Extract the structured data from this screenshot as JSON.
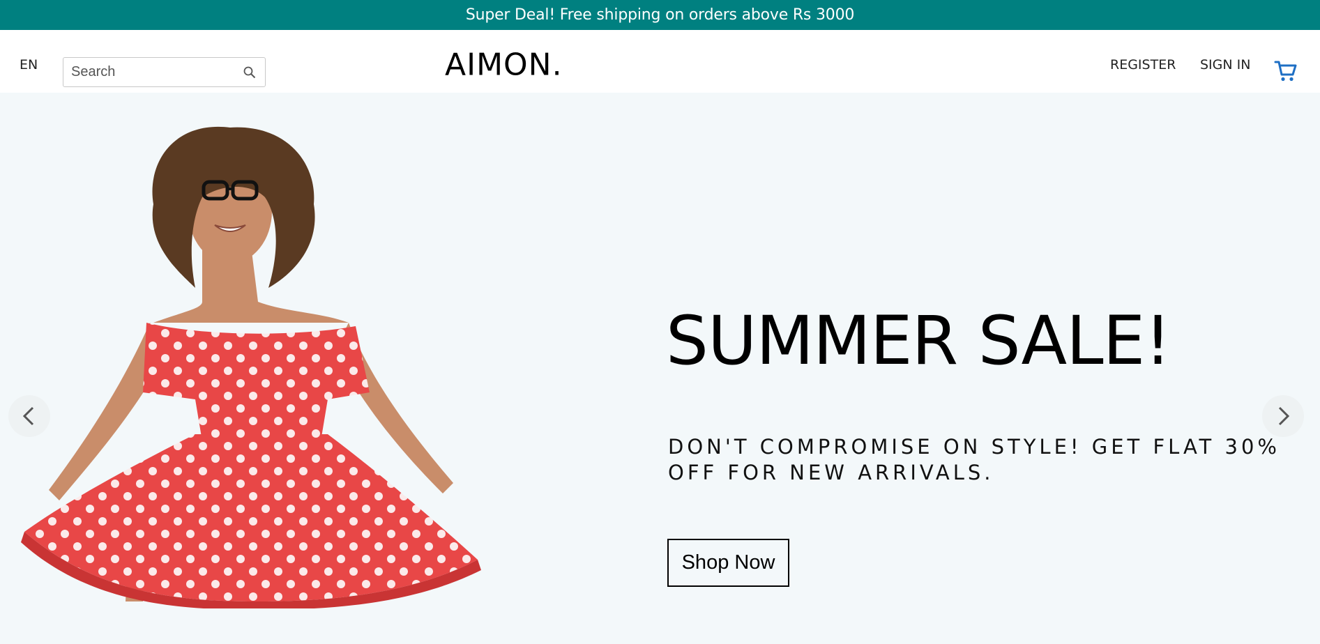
{
  "announcement": {
    "text": "Super Deal! Free shipping on orders above Rs 3000"
  },
  "header": {
    "language": "EN",
    "search": {
      "placeholder": "Search",
      "value": ""
    },
    "logo": "AIMON.",
    "register_label": "REGISTER",
    "signin_label": "SIGN IN",
    "cart_icon": "cart-icon"
  },
  "hero": {
    "title": "SUMMER SALE!",
    "subtitle": "DON'T COMPROMISE ON STYLE! GET FLAT 30% OFF FOR NEW ARRIVALS.",
    "cta_label": "Shop Now",
    "image": "woman-in-red-polka-dot-dress",
    "prev_icon": "chevron-left-icon",
    "next_icon": "chevron-right-icon"
  },
  "colors": {
    "announcement_bg": "#008080",
    "hero_bg": "#f3f8fa",
    "cart_accent": "#1e6fc4",
    "dress_red": "#e84747"
  }
}
